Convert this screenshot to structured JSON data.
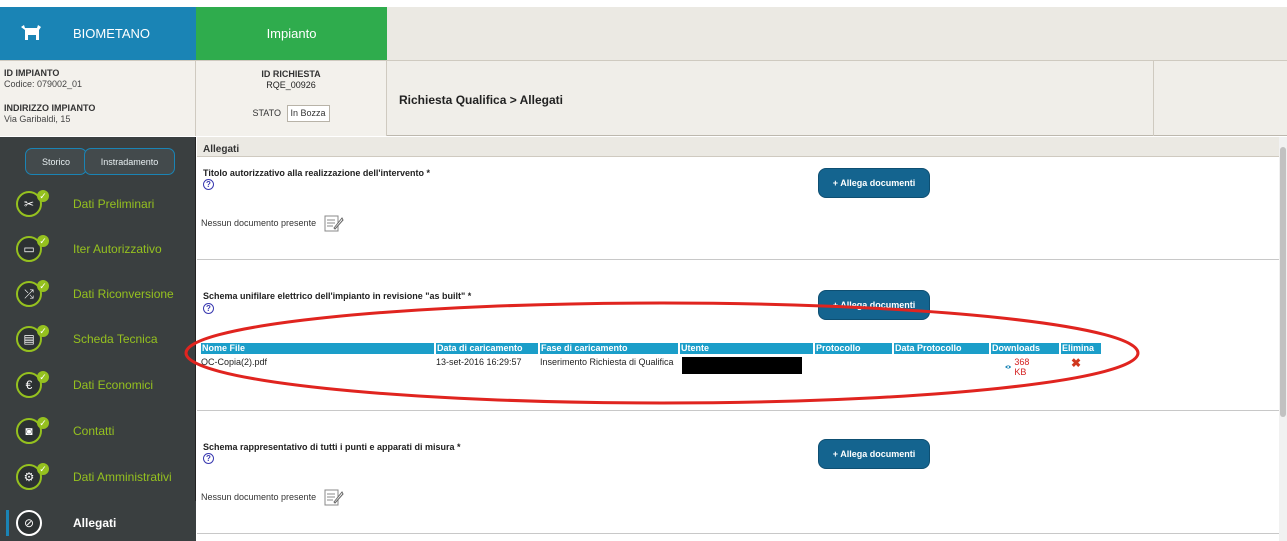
{
  "topbar": {
    "brand_label": "BIOMETANO",
    "tab_label": "Impianto",
    "brand_color": "#1a84b5",
    "tab_color": "#2fac4d",
    "cow_icon": "cow-icon"
  },
  "info": {
    "id_impianto_label": "ID IMPIANTO",
    "id_impianto_value": "Codice: 079002_01",
    "indirizzo_label": "INDIRIZZO IMPIANTO",
    "indirizzo_value": "Via Garibaldi, 15",
    "id_richiesta_label": "ID RICHIESTA",
    "id_richiesta_value": "RQE_00926",
    "stato_label": "STATO",
    "stato_value": "In Bozza",
    "page_title": "Richiesta Qualifica > Allegati"
  },
  "sidebar": {
    "storico": "Storico",
    "instradamento": "Instradamento",
    "accent_color": "#95c11f",
    "items": [
      {
        "label": "Dati Preliminari",
        "icon": "tools-icon",
        "glyph": "✂"
      },
      {
        "label": "Iter Autorizzativo",
        "icon": "document-stamp-icon",
        "glyph": "▭"
      },
      {
        "label": "Dati Riconversione",
        "icon": "shuffle-icon",
        "glyph": "⤮"
      },
      {
        "label": "Scheda Tecnica",
        "icon": "sheet-icon",
        "glyph": "▤"
      },
      {
        "label": "Dati Economici",
        "icon": "euro-icon",
        "glyph": "€"
      },
      {
        "label": "Contatti",
        "icon": "contact-card-icon",
        "glyph": "◙"
      },
      {
        "label": "Dati Amministrativi",
        "icon": "wrench-icon",
        "glyph": "⚙"
      },
      {
        "label": "Allegati",
        "icon": "paperclip-icon",
        "glyph": "⊘"
      }
    ]
  },
  "main": {
    "section_header": "Allegati",
    "sections": [
      {
        "title": "Titolo autorizzativo alla realizzazione dell'intervento *",
        "button": "+ Allega documenti",
        "empty": "Nessun documento presente"
      },
      {
        "title": "Schema unifilare elettrico dell'impianto in revisione \"as built\" *",
        "button": "+ Allega documenti",
        "empty": ""
      },
      {
        "title": "Schema rappresentativo di tutti i punti e apparati di misura *",
        "button": "+ Allega documenti",
        "empty": "Nessun documento presente"
      }
    ],
    "help_glyph": "?",
    "table": {
      "headers": [
        "Nome File",
        "Data di caricamento",
        "Fase di caricamento",
        "Utente",
        "Protocollo",
        "Data Protocollo",
        "Downloads",
        "Elimina"
      ],
      "row": {
        "nome_file": "OC-Copia(2).pdf",
        "data": "13-set-2016 16:29:57",
        "fase": "Inserimento Richiesta di Qualifica",
        "utente": "",
        "protocollo": "",
        "data_protocollo": "",
        "download_size": "368 KB",
        "delete_glyph": "✖"
      }
    }
  }
}
